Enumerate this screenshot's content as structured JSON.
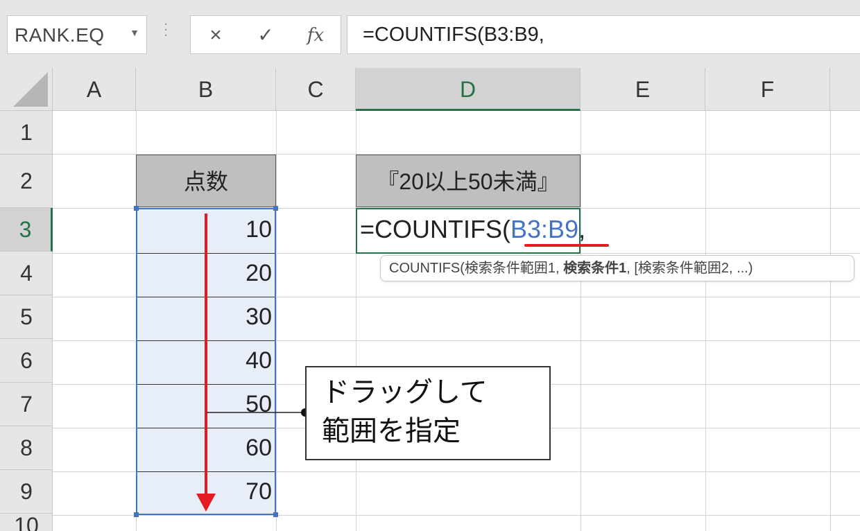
{
  "name_box": {
    "value": "RANK.EQ",
    "dropdown_icon": "chevron-down-icon"
  },
  "formula_bar": {
    "cancel_icon": "×",
    "enter_icon": "✓",
    "fx_icon": "fx",
    "formula": "=COUNTIFS(B3:B9,"
  },
  "columns": [
    "A",
    "B",
    "C",
    "D",
    "E",
    "F"
  ],
  "selected_column": "D",
  "rows": [
    "1",
    "2",
    "3",
    "4",
    "5",
    "6",
    "7",
    "8",
    "9",
    "10"
  ],
  "selected_row": "3",
  "cells": {
    "B2": "点数",
    "D2": "『20以上50未満』",
    "scores": [
      "10",
      "20",
      "30",
      "40",
      "50",
      "60",
      "70"
    ],
    "D3_prefix": "=COUNTIFS(",
    "D3_ref": "B3:B9",
    "D3_suffix": ","
  },
  "tooltip": {
    "before": "COUNTIFS(検索条件範囲1, ",
    "bold": "検索条件1",
    "after": ", [検索条件範囲2, ...)"
  },
  "callout": {
    "line1": "ドラッグして",
    "line2": "範囲を指定"
  },
  "colors": {
    "accent_green": "#217346",
    "range_blue": "#4472c4",
    "arrow_red": "#e41b23",
    "header_fill": "#bfbfbf"
  }
}
